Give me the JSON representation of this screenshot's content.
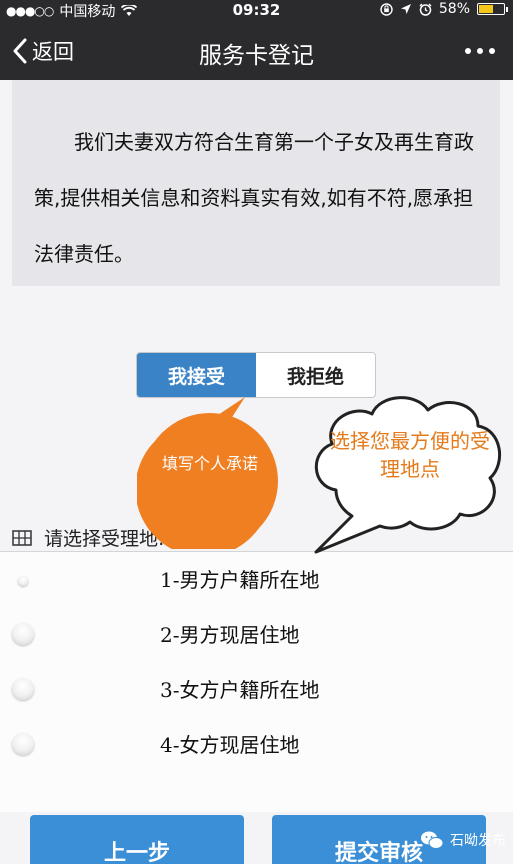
{
  "status_bar": {
    "signal_dots": "●●●○○",
    "carrier": "中国移动",
    "time": "09:32",
    "battery": "58%",
    "battery_level": 0.58
  },
  "nav": {
    "back_label": "返回",
    "title": "服务卡登记"
  },
  "notice": {
    "text": "我们夫妻双方符合生育第一个子女及再生育政策,提供相关信息和资料真实有效,如有不符,愿承担法律责任。"
  },
  "consent": {
    "accept_label": "我接受",
    "reject_label": "我拒绝"
  },
  "annotations": {
    "bubble_left": "填写个人承诺",
    "bubble_right": "选择您最方便的受理地点"
  },
  "location_section": {
    "title": "请选择受理地:",
    "options": [
      {
        "label": "1-男方户籍所在地"
      },
      {
        "label": "2-男方现居住地"
      },
      {
        "label": "3-女方户籍所在地"
      },
      {
        "label": "4-女方现居住地"
      }
    ]
  },
  "buttons": {
    "prev_label": "上一步",
    "submit_label": "提交审核"
  },
  "watermark": {
    "text": "石呦发布"
  },
  "colors": {
    "bar_bg": "#2b2b2e",
    "accent_blue": "#3a83c6",
    "button_blue": "#3a8fd6",
    "annotation_orange": "#f07f22"
  },
  "icons": [
    "wifi-icon",
    "lock-rotation-icon",
    "location-arrow-icon",
    "alarm-icon",
    "battery-icon",
    "back-chevron-icon",
    "more-dots-icon",
    "grid-icon",
    "radio-icon",
    "watermark-logo-icon"
  ]
}
